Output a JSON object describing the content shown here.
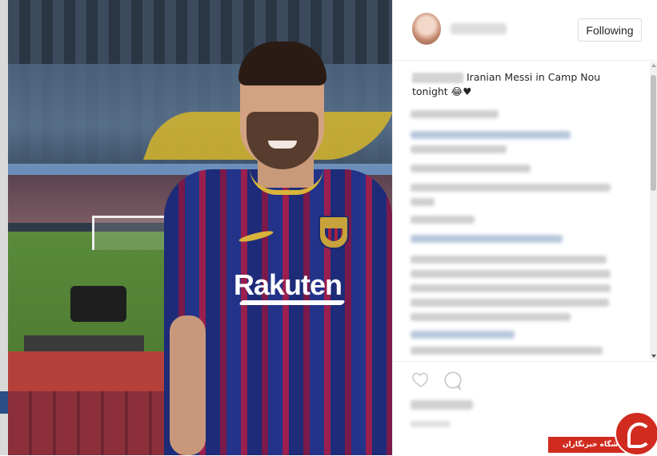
{
  "header": {
    "follow_label": "Following"
  },
  "caption": {
    "text_line1": "Iranian Messi in Camp Nou",
    "text_line2": "tonight 😂♥"
  },
  "photo": {
    "sponsor_text": "Rakuten"
  },
  "watermark": {
    "text": "باشگاه خبرنگاران"
  },
  "colors": {
    "watermark": "#d12b20",
    "jersey_blue": "#1d2b78",
    "jersey_red": "#9a1f4f"
  },
  "icons": [
    "heart-icon",
    "comment-icon"
  ]
}
